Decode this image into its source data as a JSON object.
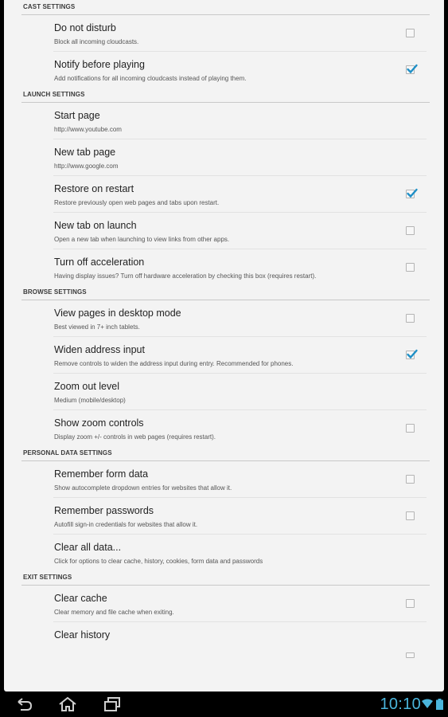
{
  "sections": [
    {
      "header": "CAST SETTINGS",
      "items": [
        {
          "title": "Do not disturb",
          "summary": "Block all incoming cloudcasts.",
          "checkbox": true,
          "checked": false
        },
        {
          "title": "Notify before playing",
          "summary": "Add notifications for all incoming cloudcasts instead of playing them.",
          "checkbox": true,
          "checked": true
        }
      ]
    },
    {
      "header": "LAUNCH SETTINGS",
      "items": [
        {
          "title": "Start page",
          "summary": "http://www.youtube.com",
          "checkbox": false,
          "checked": false
        },
        {
          "title": "New tab page",
          "summary": "http://www.google.com",
          "checkbox": false,
          "checked": false
        },
        {
          "title": "Restore on restart",
          "summary": "Restore previously open web pages and tabs upon restart.",
          "checkbox": true,
          "checked": true
        },
        {
          "title": "New tab on launch",
          "summary": "Open a new tab when launching to view links from other apps.",
          "checkbox": true,
          "checked": false
        },
        {
          "title": "Turn off acceleration",
          "summary": "Having display issues? Turn off hardware acceleration by checking this box (requires restart).",
          "checkbox": true,
          "checked": false
        }
      ]
    },
    {
      "header": "BROWSE SETTINGS",
      "items": [
        {
          "title": "View pages in desktop mode",
          "summary": "Best viewed in 7+ inch tablets.",
          "checkbox": true,
          "checked": false
        },
        {
          "title": "Widen address input",
          "summary": "Remove controls to widen the address input during entry. Recommended for phones.",
          "checkbox": true,
          "checked": true
        },
        {
          "title": "Zoom out level",
          "summary": "Medium (mobile/desktop)",
          "checkbox": false,
          "checked": false
        },
        {
          "title": "Show zoom controls",
          "summary": "Display zoom +/- controls in web pages (requires restart).",
          "checkbox": true,
          "checked": false
        }
      ]
    },
    {
      "header": "PERSONAL DATA SETTINGS",
      "items": [
        {
          "title": "Remember form data",
          "summary": "Show autocomplete dropdown entries for websites that allow it.",
          "checkbox": true,
          "checked": false
        },
        {
          "title": "Remember passwords",
          "summary": "Autofill sign-in credentials for websites that allow it.",
          "checkbox": true,
          "checked": false
        },
        {
          "title": "Clear all data...",
          "summary": "Click for options to clear cache, history, cookies, form data and passwords",
          "checkbox": false,
          "checked": false
        }
      ]
    },
    {
      "header": "EXIT SETTINGS",
      "items": [
        {
          "title": "Clear cache",
          "summary": "Clear memory and file cache when exiting.",
          "checkbox": true,
          "checked": false
        },
        {
          "title": "Clear history",
          "summary": "",
          "checkbox": true,
          "checked": false
        }
      ]
    }
  ],
  "navbar": {
    "back_icon": "back-icon",
    "home_icon": "home-icon",
    "recents_icon": "recent-apps-icon",
    "clock": "10:10"
  },
  "colors": {
    "accent": "#1e8fc6",
    "clock": "#4ab5dc",
    "background": "#f3f3f3"
  }
}
